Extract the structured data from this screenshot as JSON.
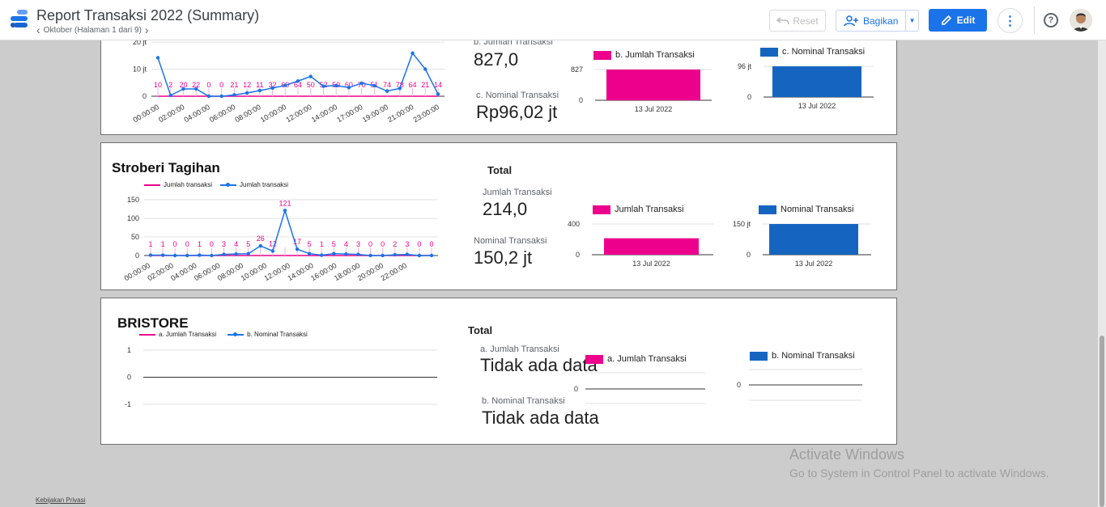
{
  "header": {
    "title": "Report Transaksi 2022 (Summary)",
    "page_label": "Oktober (Halaman 1 dari 9)",
    "reset_label": "Reset",
    "share_label": "Bagikan",
    "edit_label": "Edit",
    "help_symbol": "?"
  },
  "colors": {
    "pink": "#ec008c",
    "blue": "#1a73e8",
    "bar_blue": "#1565c0",
    "accent": "#1a73e8"
  },
  "icons": [
    "datastudio-logo-icon",
    "chevron-left-icon",
    "chevron-right-icon",
    "undo-icon",
    "person-add-icon",
    "caret-down-icon",
    "pencil-icon",
    "more-vert-icon",
    "help-icon",
    "avatar"
  ],
  "panel1": {
    "top_label": "b. Jumlah Transaksi",
    "count_value": "827,0",
    "nominal_label": "c. Nominal Transaksi",
    "nominal_value": "Rp96,02 jt",
    "bar1_legend": "b. Jumlah Transaksi",
    "bar2_legend": "c. Nominal Transaksi"
  },
  "panel2": {
    "title": "Stroberi Tagihan",
    "total_label": "Total",
    "count_label": "Jumlah Transaksi",
    "count_value": "214,0",
    "nominal_label": "Nominal Transaksi",
    "nominal_value": "150,2 jt",
    "bar1_legend": "Jumlah Transaksi",
    "bar2_legend": "Nominal Transaksi",
    "line_legend_1": "Jumlah transaksi",
    "line_legend_2": "Jumlah transaksi"
  },
  "panel3": {
    "title": "BRISTORE",
    "total_label": "Total",
    "count_label": "a. Jumlah Transaksi",
    "count_value": "Tidak ada data",
    "nominal_label": "b. Nominal Transaksi",
    "nominal_value": "Tidak ada data",
    "bar1_legend": "a. Jumlah Transaksi",
    "bar2_legend": "b. Nominal Transaksi",
    "line_legend_1": "a. Jumlah Transaksi",
    "line_legend_2": "b. Nominal Transaksi"
  },
  "watermark": {
    "line1": "Activate Windows",
    "line2": "Go to System in Control Panel to activate Windows."
  },
  "footer": {
    "privacy": "Kebijakan Privasi"
  },
  "chart_data": [
    {
      "type": "line",
      "x_tick_labels": [
        "00:00:00",
        "02:00:00",
        "04:00:00",
        "06:00:00",
        "08:00:00",
        "10:00:00",
        "12:00:00",
        "14:00:00",
        "17:00:00",
        "19:00:00",
        "21:00:00",
        "23:00:00"
      ],
      "y_tick_labels": [
        "20 jt",
        "10 jt",
        "0"
      ],
      "count_labels": [
        "10",
        "2",
        "20",
        "22",
        "0",
        "0",
        "21",
        "12",
        "11",
        "32",
        "60",
        "64",
        "50",
        "52",
        "59",
        "60",
        "70",
        "51",
        "74",
        "78",
        "64",
        "21",
        "14"
      ],
      "nominal_series_jt": [
        14.2,
        0.3,
        2.7,
        2.7,
        0,
        0,
        0.5,
        1.2,
        2.1,
        3,
        4,
        5.6,
        7.3,
        3.7,
        3.9,
        3.2,
        4.8,
        3.9,
        1.9,
        2.9,
        15.9,
        10,
        0.8
      ],
      "ylim": [
        0,
        20
      ]
    },
    {
      "type": "bar",
      "categories": [
        "13 Jul 2022"
      ],
      "series": [
        {
          "name": "b. Jumlah Transaksi",
          "values": [
            827
          ]
        }
      ],
      "y_tick_labels": [
        "827",
        "0"
      ]
    },
    {
      "type": "bar",
      "categories": [
        "13 Jul 2022"
      ],
      "series": [
        {
          "name": "c. Nominal Transaksi",
          "values": [
            96
          ]
        }
      ],
      "y_tick_labels": [
        "96 jt",
        "0"
      ]
    },
    {
      "type": "line",
      "x_tick_labels": [
        "00:00:00",
        "02:00:00",
        "04:00:00",
        "06:00:00",
        "08:00:00",
        "10:00:00",
        "12:00:00",
        "14:00:00",
        "16:00:00",
        "18:00:00",
        "20:00:00",
        "22:00:00"
      ],
      "y_tick_labels": [
        "150",
        "100",
        "50",
        "0"
      ],
      "ylim": [
        0,
        150
      ],
      "series": [
        {
          "name": "Jumlah transaksi",
          "values": [
            1,
            1,
            0,
            0,
            1,
            0,
            3,
            4,
            5,
            26,
            12,
            121,
            17,
            5,
            1,
            5,
            4,
            3,
            0,
            0,
            2,
            3,
            0,
            0
          ]
        },
        {
          "name": "Jumlah transaksi",
          "values": [
            1,
            1,
            0,
            0,
            1,
            0,
            3,
            4,
            5,
            26,
            12,
            121,
            17,
            5,
            1,
            5,
            4,
            3,
            0,
            0,
            2,
            3,
            0,
            0
          ]
        }
      ],
      "data_labels": [
        "1",
        "1",
        "0",
        "0",
        "1",
        "0",
        "3",
        "4",
        "5",
        "26",
        "12",
        "121",
        "17",
        "5",
        "1",
        "5",
        "4",
        "3",
        "0",
        "0",
        "2",
        "3",
        "0",
        "0"
      ]
    },
    {
      "type": "bar",
      "categories": [
        "13 Jul 2022"
      ],
      "series": [
        {
          "name": "Jumlah Transaksi",
          "values": [
            214
          ]
        }
      ],
      "y_tick_labels": [
        "400",
        "0"
      ],
      "ylim": [
        0,
        400
      ]
    },
    {
      "type": "bar",
      "categories": [
        "13 Jul 2022"
      ],
      "series": [
        {
          "name": "Nominal Transaksi",
          "values": [
            150.2
          ]
        }
      ],
      "y_tick_labels": [
        "150 jt",
        "0"
      ]
    },
    {
      "type": "line",
      "y_tick_labels": [
        "1",
        "0",
        "-1"
      ],
      "ylim": [
        -1,
        1
      ],
      "series": [
        {
          "name": "a. Jumlah Transaksi",
          "values": []
        },
        {
          "name": "b. Nominal Transaksi",
          "values": []
        }
      ]
    },
    {
      "type": "bar",
      "series": [
        {
          "name": "a. Jumlah Transaksi",
          "values": []
        }
      ],
      "y_tick_labels": [
        "0"
      ]
    },
    {
      "type": "bar",
      "series": [
        {
          "name": "b. Nominal Transaksi",
          "values": []
        }
      ],
      "y_tick_labels": [
        "0"
      ]
    }
  ]
}
